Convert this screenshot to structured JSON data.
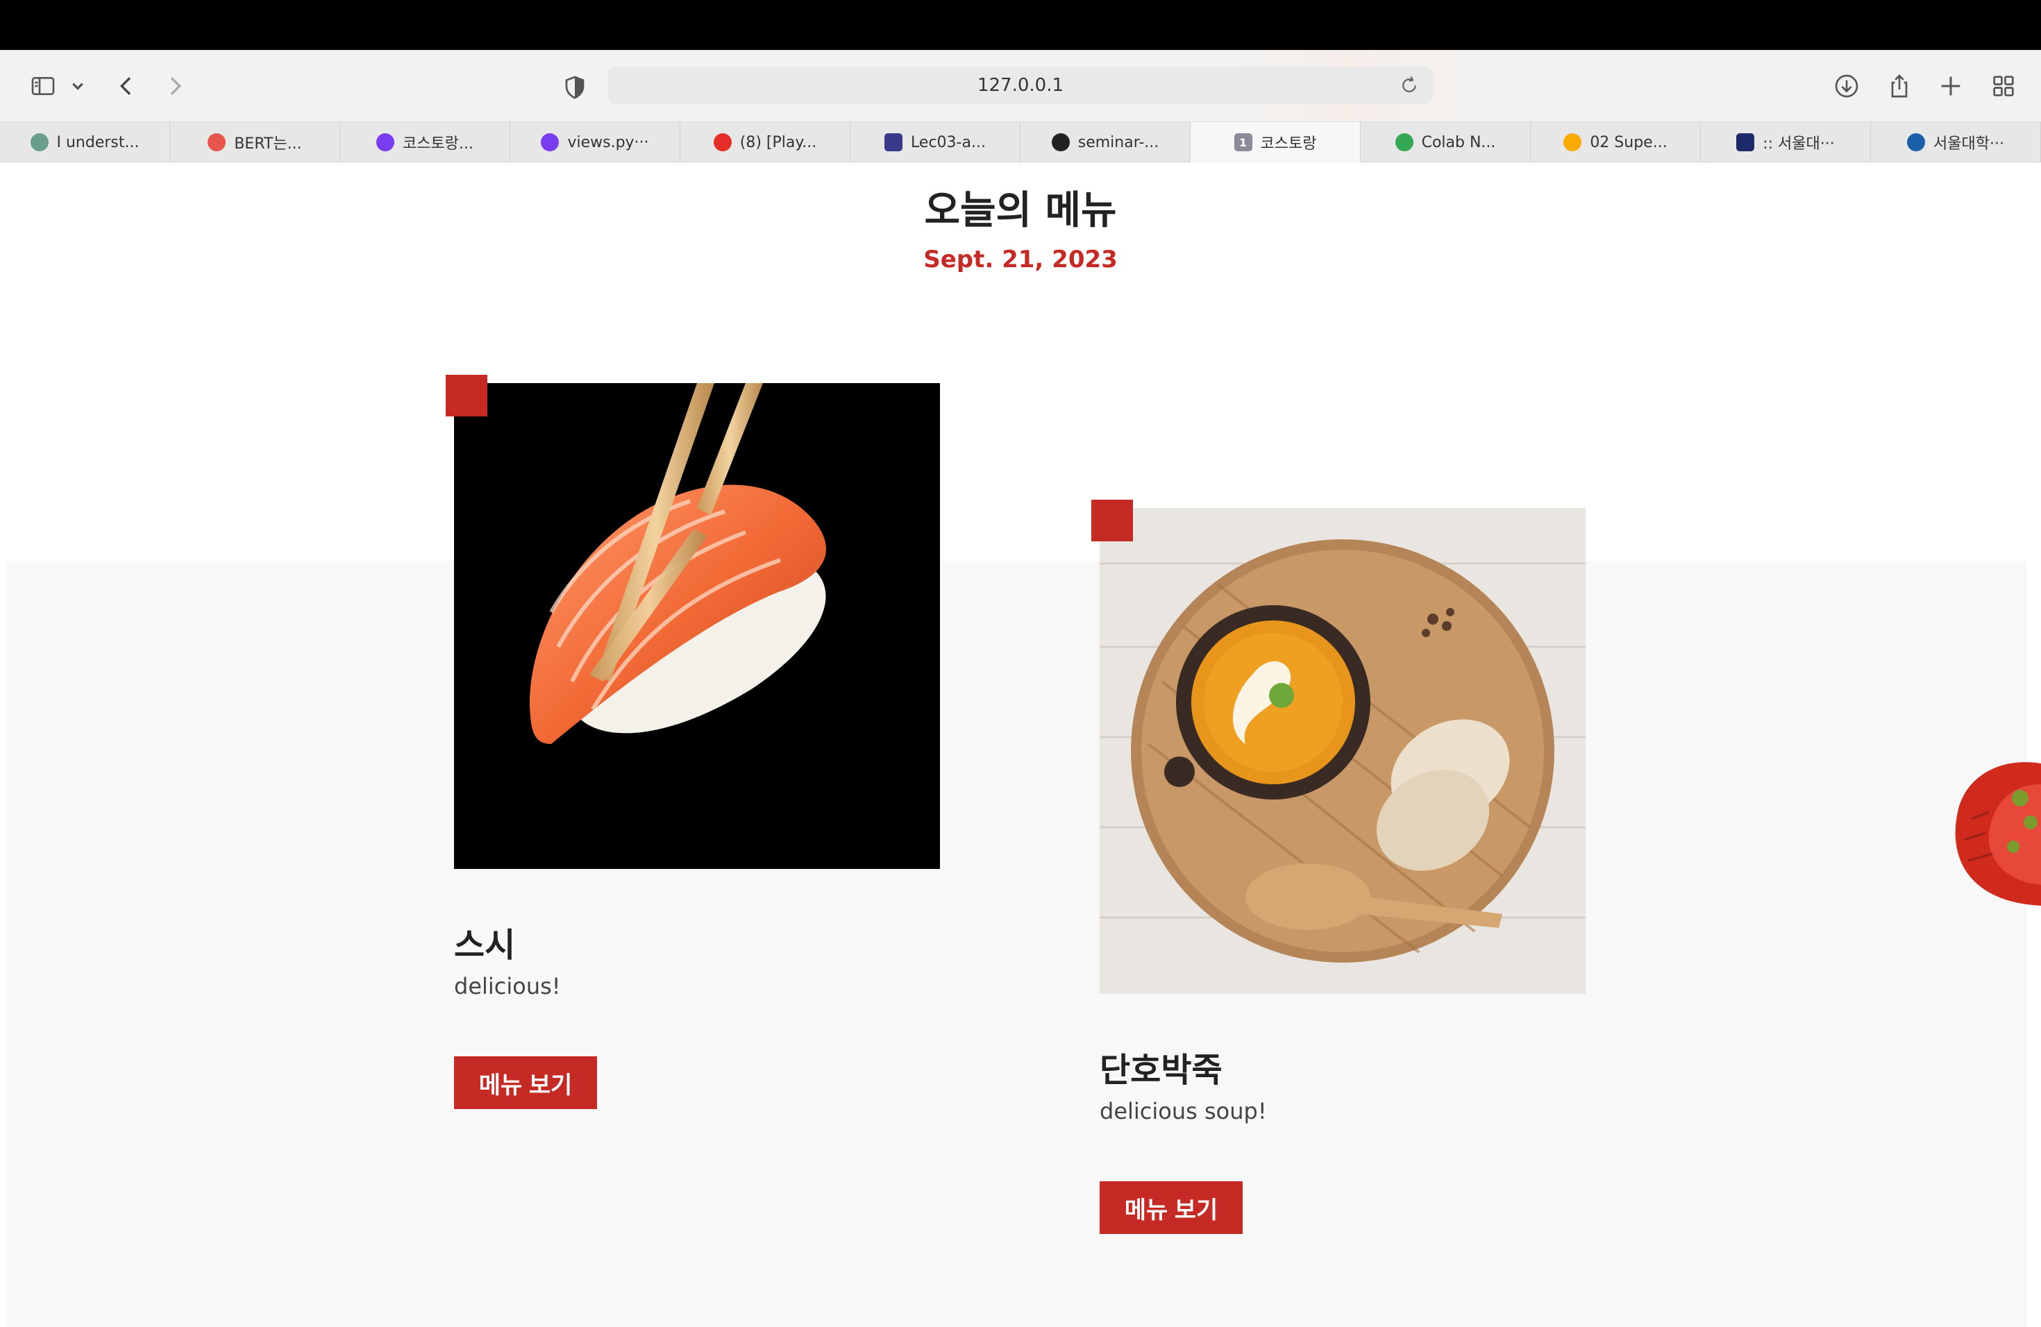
{
  "browser": {
    "url": "127.0.0.1",
    "tabs": [
      {
        "label": "I underst...",
        "icon": "chatgpt-icon",
        "color": "#6a9e8c"
      },
      {
        "label": "BERT는...",
        "icon": "red-circle-icon",
        "color": "#e8554a"
      },
      {
        "label": "코스토랑...",
        "icon": "codeit-icon",
        "color": "#7a3cf0"
      },
      {
        "label": "views.py···",
        "icon": "codeit-icon",
        "color": "#7a3cf0"
      },
      {
        "label": "(8) [Play...",
        "icon": "youtube-icon",
        "color": "#e52d27"
      },
      {
        "label": "Lec03-a...",
        "icon": "university-icon",
        "color": "#3a3a8a"
      },
      {
        "label": "seminar-...",
        "icon": "github-icon",
        "color": "#222222"
      },
      {
        "label": "코스토랑",
        "icon": "number-one-icon",
        "color": "#8a8a9a",
        "active": true
      },
      {
        "label": "Colab N...",
        "icon": "google-drive-icon",
        "color": "#34a853"
      },
      {
        "label": "02 Supe...",
        "icon": "colab-icon",
        "color": "#f9ab00"
      },
      {
        "label": ":: 서울대···",
        "icon": "snu-icon",
        "color": "#1d2b6b"
      },
      {
        "label": "서울대학···",
        "icon": "snu-logo-icon",
        "color": "#1a5fa8"
      }
    ]
  },
  "page": {
    "title": "오늘의 메뉴",
    "date": "Sept. 21, 2023"
  },
  "menu": [
    {
      "name": "스시",
      "description": "delicious!",
      "button": "메뉴 보기",
      "image": "sushi-image"
    },
    {
      "name": "단호박죽",
      "description": "delicious soup!",
      "button": "메뉴 보기",
      "image": "pumpkin-soup-image"
    }
  ],
  "colors": {
    "accent": "#c62a24"
  }
}
